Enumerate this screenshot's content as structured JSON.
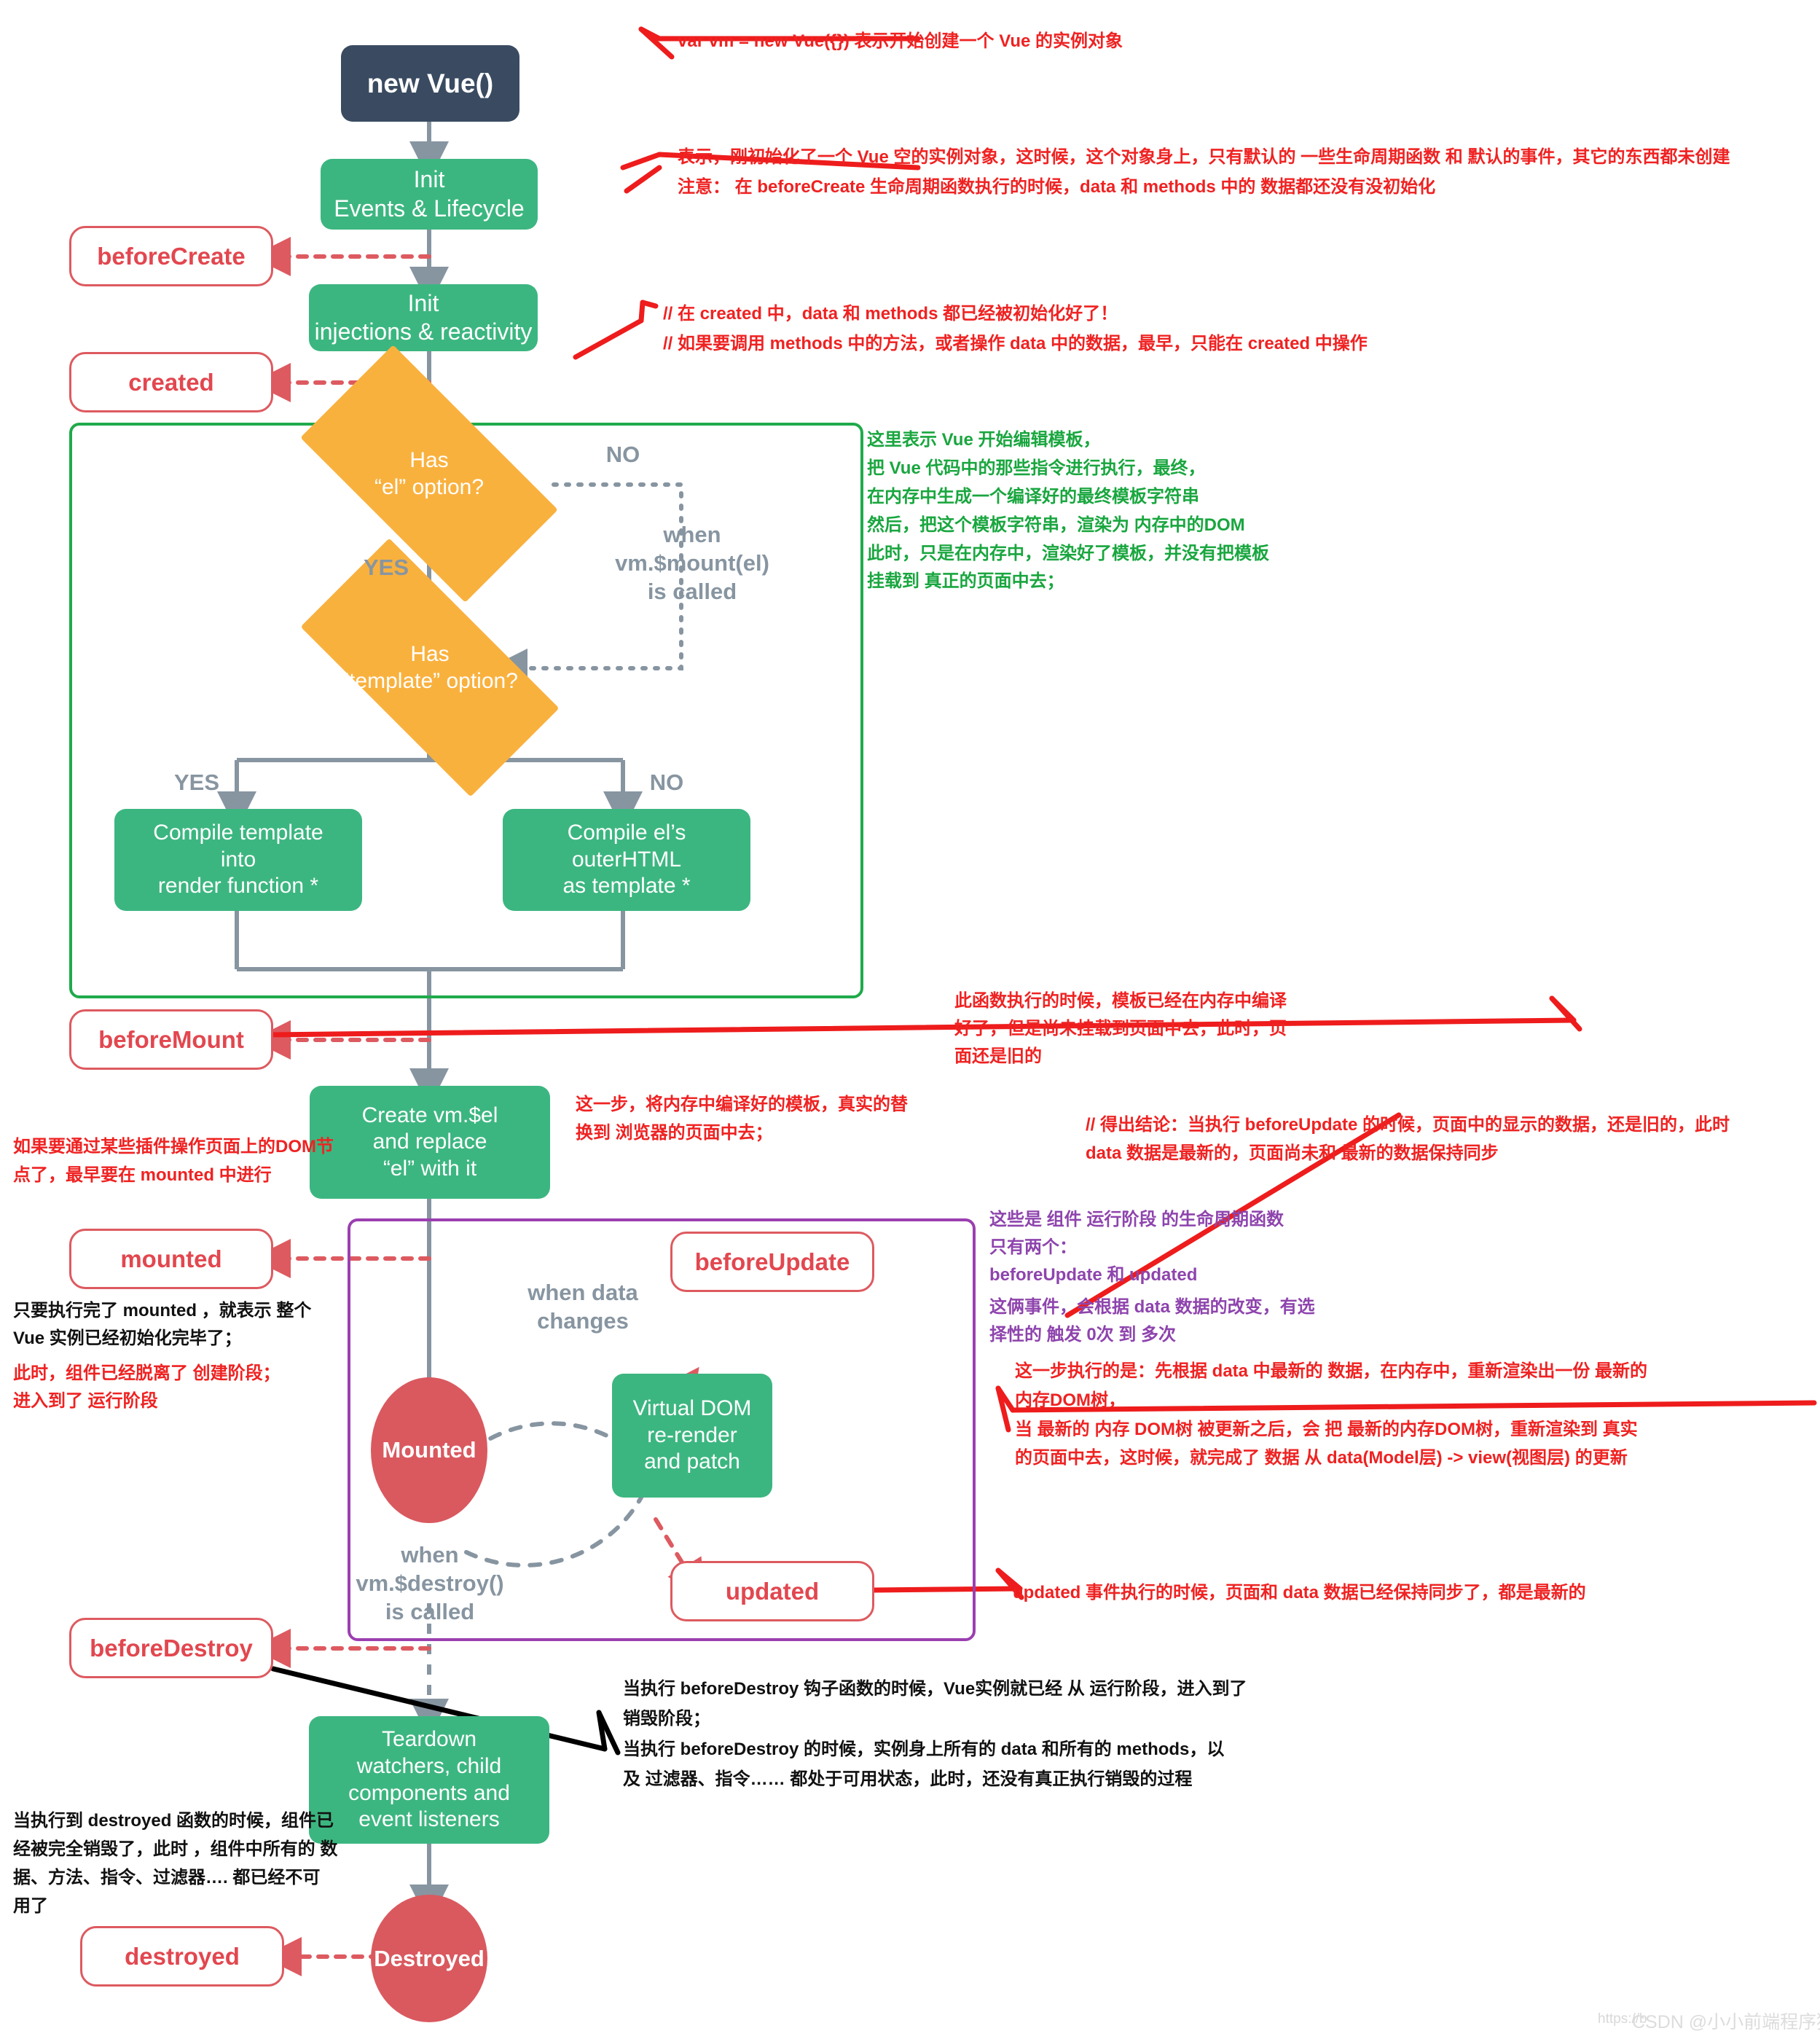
{
  "diagram": {
    "title": "Vue Lifecycle Diagram (annotated, Chinese)",
    "colors": {
      "dark": "#3a4b61",
      "green": "#3cb680",
      "orange": "#f9b13e",
      "hook_red": "#dd5a60",
      "hook_text": "#e2474f",
      "ellipse_red": "#d9595f",
      "gray_connector": "#8795a1",
      "green_frame": "#1faa4b",
      "purple_frame": "#9b3fb0",
      "annotation_red": "#ef2222",
      "annotation_green": "#19a63f",
      "annotation_purple": "#8e44ad"
    }
  },
  "nodes": {
    "new_vue": "new Vue()",
    "init_events": "Init\nEvents & Lifecycle",
    "init_injections": "Init\ninjections & reactivity",
    "has_el": "Has\n“el” option?",
    "has_template": "Has\n“template” option?",
    "compile_template": "Compile template\ninto\nrender function *",
    "compile_outerhtml": "Compile el’s\nouterHTML\nas template *",
    "create_el": "Create vm.$el\nand replace\n“el” with it",
    "virtual_dom": "Virtual DOM\nre-render\nand patch",
    "teardown": "Teardown\nwatchers, child\ncomponents and\nevent listeners",
    "mounted_state": "Mounted",
    "destroyed_state": "Destroyed"
  },
  "hooks": {
    "before_create": "beforeCreate",
    "created": "created",
    "before_mount": "beforeMount",
    "mounted": "mounted",
    "before_update": "beforeUpdate",
    "updated": "updated",
    "before_destroy": "beforeDestroy",
    "destroyed": "destroyed"
  },
  "connector_labels": {
    "no_el": "NO",
    "yes_el": "YES",
    "when_mount": "when\nvm.$mount(el)\nis called",
    "yes_template": "YES",
    "no_template": "NO",
    "when_data_changes": "when data\nchanges",
    "when_destroy": "when\nvm.$destroy()\nis called"
  },
  "annotations": {
    "new_vue_note": "var vm = new Vue({})   表示开始创建一个 Vue 的实例对象",
    "before_create_note": "表示，刚初始化了一个  Vue 空的实例对象，这时候，这个对象身上，只有默认的 一些生命周期函数 和 默认的事件，其它的东西都未创建\n注意： 在 beforeCreate 生命周期函数执行的时候，data 和 methods 中的 数据都还没有没初始化",
    "created_note": "// 在 created 中，data 和 methods 都已经被初始化好了！\n// 如果要调用 methods 中的方法，或者操作 data 中的数据，最早，只能在 created 中操作",
    "compile_phase_note": "这里表示 Vue 开始编辑模板，\n把 Vue 代码中的那些指令进行执行，最终，\n在内存中生成一个编译好的最终模板字符串\n然后，把这个模板字符串，渲染为 内存中的DOM\n此时，只是在内存中，渲染好了模板，并没有把模板\n挂载到 真正的页面中去；",
    "before_mount_note": "此函数执行的时候，模板已经在内存中编译\n好了，但是尚未挂载到页面中去，此时，页\n面还是旧的",
    "create_el_note": "这一步，将内存中编译好的模板，真实的替\n换到 浏览器的页面中去；",
    "mounted_plugin_note": "如果要通过某些插件操作页面上的DOM节\n点了，最早要在 mounted 中进行",
    "mounted_note_black": "只要执行完了 mounted ，就表示 整个\nVue 实例已经初始化完毕了；",
    "mounted_note_red": "此时，组件已经脱离了 创建阶段；\n进入到了 运行阶段",
    "before_update_note": "// 得出结论：当执行 beforeUpdate 的时候，页面中的显示的数据，还是旧的，此时\n   data 数据是最新的，页面尚未和 最新的数据保持同步",
    "running_phase_note": "这些是 组件 运行阶段 的生命周期函数\n只有两个：\nbeforeUpdate 和  updated",
    "running_phase_note2": "这俩事件，会根据 data 数据的改变，有选\n择性的 触发 0次 到 多次",
    "virtual_dom_note": "这一步执行的是：先根据 data 中最新的 数据，在内存中，重新渲染出一份 最新的\n内存DOM树，\n当 最新的 内存 DOM树 被更新之后，会 把 最新的内存DOM树，重新渲染到 真实\n的页面中去，这时候，就完成了 数据 从  data(Model层) ->  view(视图层) 的更新",
    "updated_note": "updated 事件执行的时候，页面和 data 数据已经保持同步了，都是最新的",
    "before_destroy_note": "当执行 beforeDestroy 钩子函数的时候，Vue实例就已经 从 运行阶段，进入到了\n销毁阶段；\n当执行  beforeDestroy  的时候，实例身上所有的 data 和所有的 methods，以\n及 过滤器、指令……  都处于可用状态，此时，还没有真正执行销毁的过程",
    "destroyed_note": "当执行到 destroyed 函数的时候，组件已\n经被完全销毁了，此时 ，组件中所有的 数\n据、方法、指令、过滤器…. 都已经不可\n用了"
  },
  "watermark": {
    "text": "CSDN @小小前端程序猿",
    "url_text": "https://b"
  }
}
